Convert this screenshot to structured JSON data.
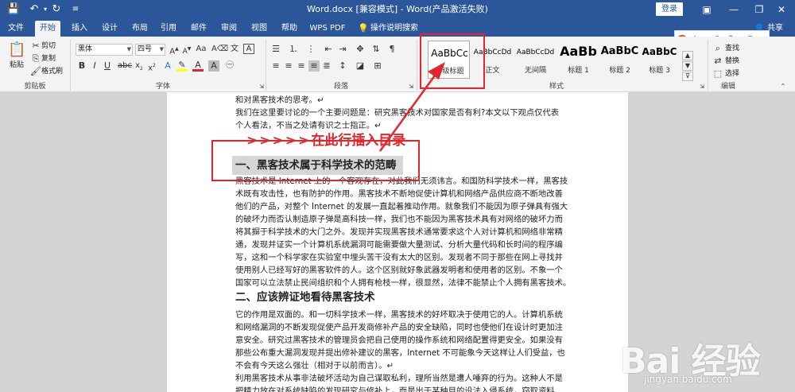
{
  "titlebar": {
    "title": "Word.docx [兼容模式] - Word(产品激活失败)",
    "login_label": "登录",
    "icons": [
      "save-icon",
      "undo-icon",
      "redo-icon",
      "customize-icon"
    ],
    "background": "#2b579a"
  },
  "tabs": [
    "文件",
    "开始",
    "插入",
    "设计",
    "布局",
    "引用",
    "邮件",
    "审阅",
    "视图",
    "帮助",
    "WPS PDF",
    "操作说明搜索"
  ],
  "active_tab": "开始",
  "share_label": "共享",
  "ime": {
    "label": "中"
  },
  "ribbon": {
    "clipboard": {
      "paste": "粘贴",
      "cut": "剪切",
      "copy": "复制",
      "format_painter": "格式刷",
      "label": "剪贴板"
    },
    "font": {
      "name": "黑体",
      "size": "四号",
      "bold": "B",
      "italic": "I",
      "underline": "U",
      "label": "字体"
    },
    "paragraph": {
      "label": "段落"
    },
    "styles": {
      "label": "样式",
      "items": [
        {
          "sample": "AaBbCc",
          "name": "一级标题"
        },
        {
          "sample": "AaBbCcDd",
          "name": "正文"
        },
        {
          "sample": "AaBbCcDd",
          "name": "无间隔"
        },
        {
          "sample": "AaBb",
          "name": "标题 1"
        },
        {
          "sample": "AaBbC",
          "name": "标题 2"
        },
        {
          "sample": "AaBbC",
          "name": "标题 3"
        }
      ]
    },
    "editing": {
      "find": "查找",
      "replace": "替换",
      "select": "选择",
      "label": "编辑"
    }
  },
  "document": {
    "lines_top": [
      "和对黑客技术的思考。↵",
      "我们在这里要讨论的一个主要问题是：研究黑客技术对国家是否有利?本文以下观点仅代表",
      "个人看法，不当之处请有识之士指正。↵"
    ],
    "annotation": "在此行插入目录",
    "heading1": "一、黑客技术属于科学技术的范畴",
    "lines_mid": [
      "黑客技术是 Internet 上的一个客观存在，对此我们无须讳言。和国防科学技术一样，黑客技",
      "术既有攻击性，也有防护的作用。黑客技术不断地促使计算机和网络产品供应商不断地改善",
      "他们的产品，对整个 Internet 的发展一直起着推动作用。就象我们不能因为原子弹具有强大",
      "的破坏力而否认制造原子弹是高科技一样，我们也不能因为黑客技术具有对网络的破坏力而",
      "将其摒于科学技术的大门之外。发现并实现黑客技术通常要求这个人对计算机和网络非常精",
      "通，发现并证实一个计算机系统漏洞可能需要做大量测试、分析大量代码和长时间的程序编",
      "写，这和一个科学家在实验室中埋头苦干没有太大的区别。发现者不同于那些在网上寻找并",
      "使用别人已经写好的黑客软件的人。这个区别就好象武器发明者和使用者的区别。不象一个",
      "国家可以立法禁止民间组织和个人拥有枪枝一样，很显然，法律不能禁止个人拥有黑客技术。↵"
    ],
    "heading2": "二、应该辨证地看待黑客技术",
    "lines_bottom": [
      "它的作用是双面的。和一切科学技术一样，黑客技术的好坏取决于使用它的人。计算机系统",
      "和网络漏洞的不断发现促使产品开发商修补产品的安全缺陷，同时也使他们在设计时更加注",
      "意安全。研究过黑客技术的管理员会把自己使用的操作系统和网络配置得更安全。如果没有",
      "那些公布重大漏洞发现并提出修补建议的黑客，Internet 不可能象今天这样让人们受益，也",
      "不会有今天这么强壮（相对于以前而言）。↵",
      "利用黑客技术从事非法破坏活动为自己谋取私利，理所当然是遭人唾弃的行为。这种人不是",
      "把精力放在对系统缺陷的发现研究与修补上，而是出于某种目的设法入侵系统，窃取资料、"
    ]
  },
  "watermark": {
    "logo": "Bai 经验",
    "url": "jingyan.baidu.com"
  },
  "colors": {
    "accent": "#2b579a",
    "annotation_red": "#e4262c",
    "ribbon_bg": "#f3f3f3"
  }
}
